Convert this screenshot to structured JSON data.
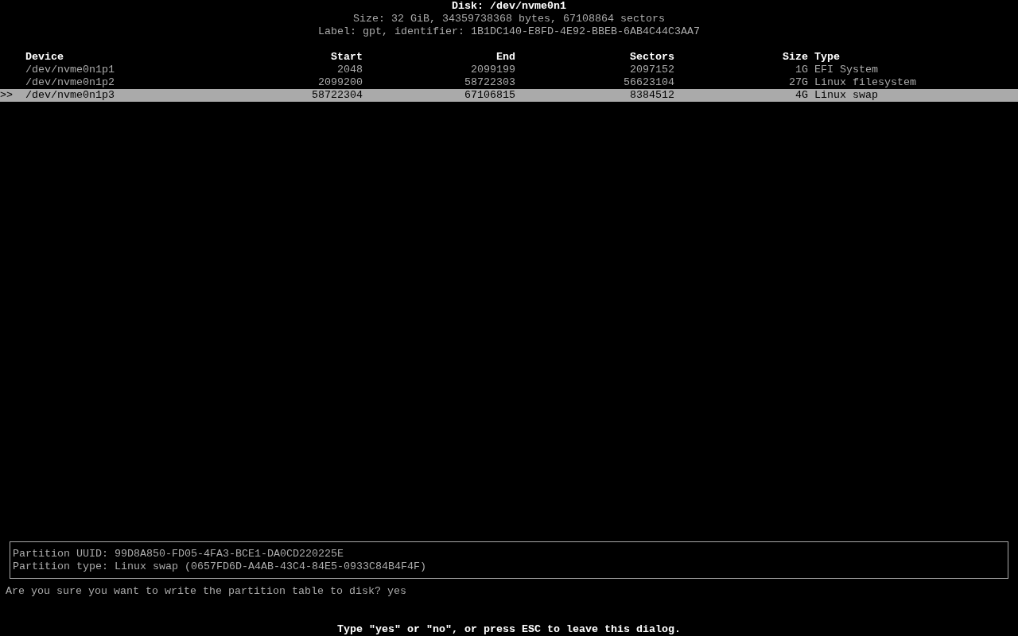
{
  "header": {
    "title": "Disk: /dev/nvme0n1",
    "size": "Size: 32 GiB, 34359738368 bytes, 67108864 sectors",
    "label": "Label: gpt, identifier: 1B1DC140-E8FD-4E92-BBEB-6AB4C44C3AA7"
  },
  "table": {
    "columns": [
      "Device",
      "Start",
      "End",
      "Sectors",
      "Size",
      "Type"
    ],
    "selection_marker": ">>",
    "rows": [
      {
        "device": "/dev/nvme0n1p1",
        "start": "2048",
        "end": "2099199",
        "sectors": "2097152",
        "size": "1G",
        "type": "EFI System",
        "selected": false
      },
      {
        "device": "/dev/nvme0n1p2",
        "start": "2099200",
        "end": "58722303",
        "sectors": "56623104",
        "size": "27G",
        "type": "Linux filesystem",
        "selected": false
      },
      {
        "device": "/dev/nvme0n1p3",
        "start": "58722304",
        "end": "67106815",
        "sectors": "8384512",
        "size": "4G",
        "type": "Linux swap",
        "selected": true
      }
    ]
  },
  "info": [
    "Partition UUID: 99D8A850-FD05-4FA3-BCE1-DA0CD220225E",
    "Partition type: Linux swap (0657FD6D-A4AB-43C4-84E5-0933C84B4F4F)"
  ],
  "prompt": {
    "question": "Are you sure you want to write the partition table to disk?",
    "value": "yes"
  },
  "hint": "Type \"yes\" or \"no\", or press ESC to leave this dialog."
}
